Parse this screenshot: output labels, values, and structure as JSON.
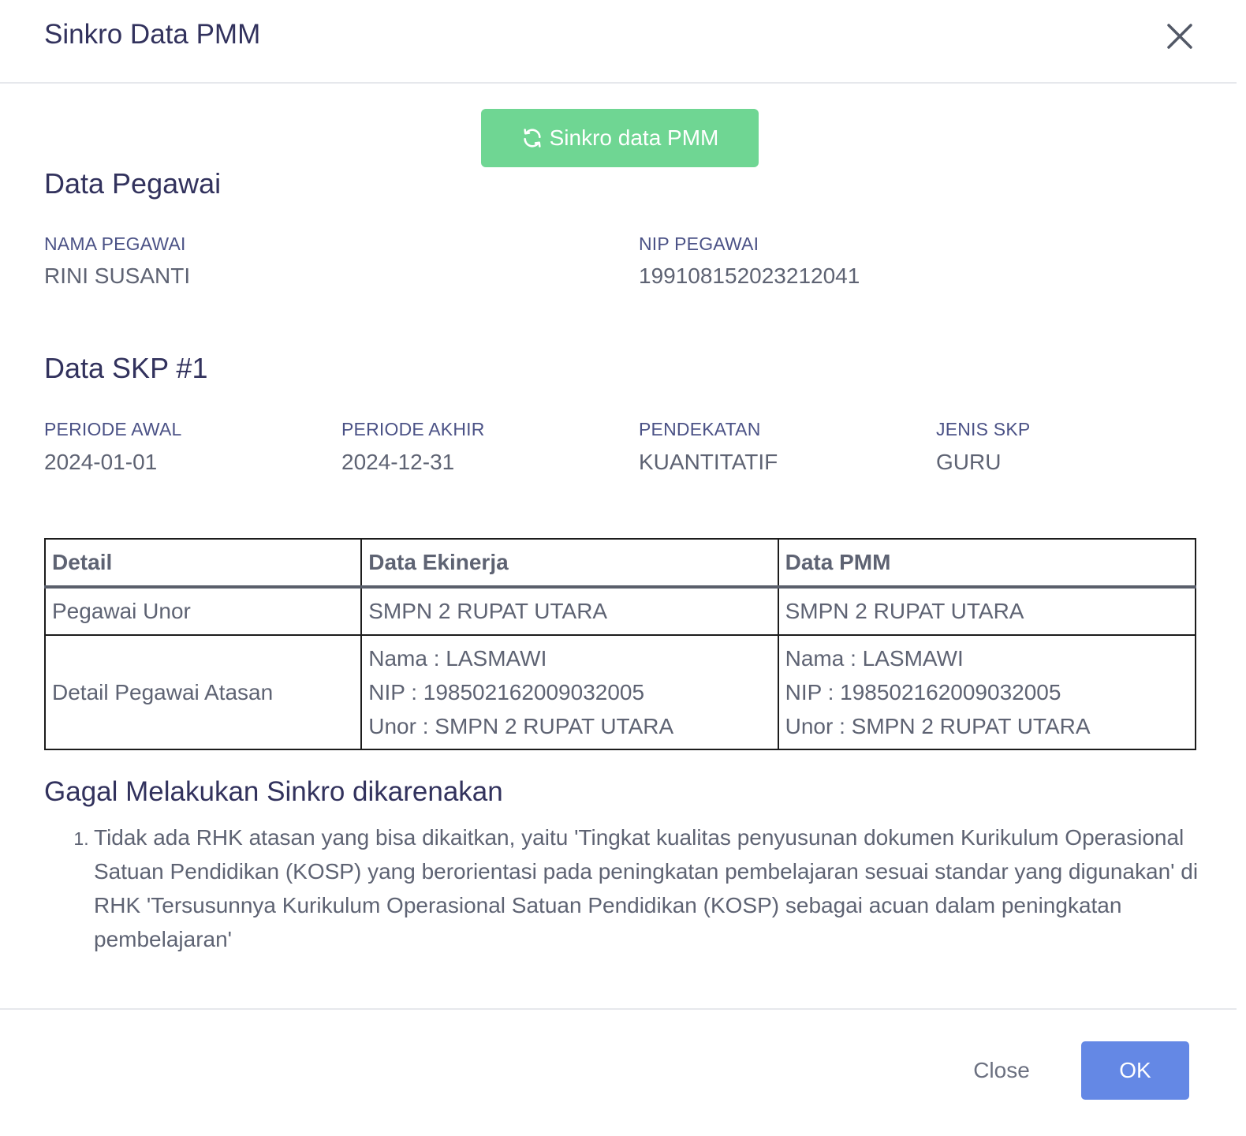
{
  "header": {
    "title": "Sinkro Data PMM"
  },
  "sync_button": {
    "label": "Sinkro data PMM",
    "icon": "refresh-icon",
    "color": "#6fd693"
  },
  "pegawai": {
    "section_title": "Data Pegawai",
    "nama_label": "NAMA PEGAWAI",
    "nama_value": "RINI SUSANTI",
    "nip_label": "NIP PEGAWAI",
    "nip_value": "199108152023212041"
  },
  "skp": {
    "section_title": "Data SKP #1",
    "fields": [
      {
        "label": "PERIODE AWAL",
        "value": "2024-01-01"
      },
      {
        "label": "PERIODE AKHIR",
        "value": "2024-12-31"
      },
      {
        "label": "PENDEKATAN",
        "value": "KUANTITATIF"
      },
      {
        "label": "JENIS SKP",
        "value": "GURU"
      }
    ]
  },
  "table": {
    "headers": [
      "Detail",
      "Data Ekinerja",
      "Data PMM"
    ],
    "rows": [
      {
        "detail": "Pegawai Unor",
        "ekinerja": [
          "SMPN 2 RUPAT UTARA"
        ],
        "pmm": [
          "SMPN 2 RUPAT UTARA"
        ]
      },
      {
        "detail": "Detail Pegawai Atasan",
        "ekinerja": [
          "Nama : LASMAWI",
          "NIP : 198502162009032005",
          "Unor : SMPN 2 RUPAT UTARA"
        ],
        "pmm": [
          "Nama : LASMAWI",
          "NIP : 198502162009032005",
          "Unor : SMPN 2 RUPAT UTARA"
        ]
      }
    ]
  },
  "error": {
    "title": "Gagal Melakukan Sinkro dikarenakan",
    "items": [
      "Tidak ada RHK atasan yang bisa dikaitkan, yaitu 'Tingkat kualitas penyusunan dokumen Kurikulum Operasional Satuan Pendidikan (KOSP) yang berorientasi pada peningkatan pembelajaran sesuai standar yang digunakan' di RHK 'Tersusunnya Kurikulum Operasional Satuan Pendidikan (KOSP) sebagai acuan dalam peningkatan pembelajaran'"
    ]
  },
  "footer": {
    "close_label": "Close",
    "ok_label": "OK",
    "ok_color": "#6488e5"
  }
}
